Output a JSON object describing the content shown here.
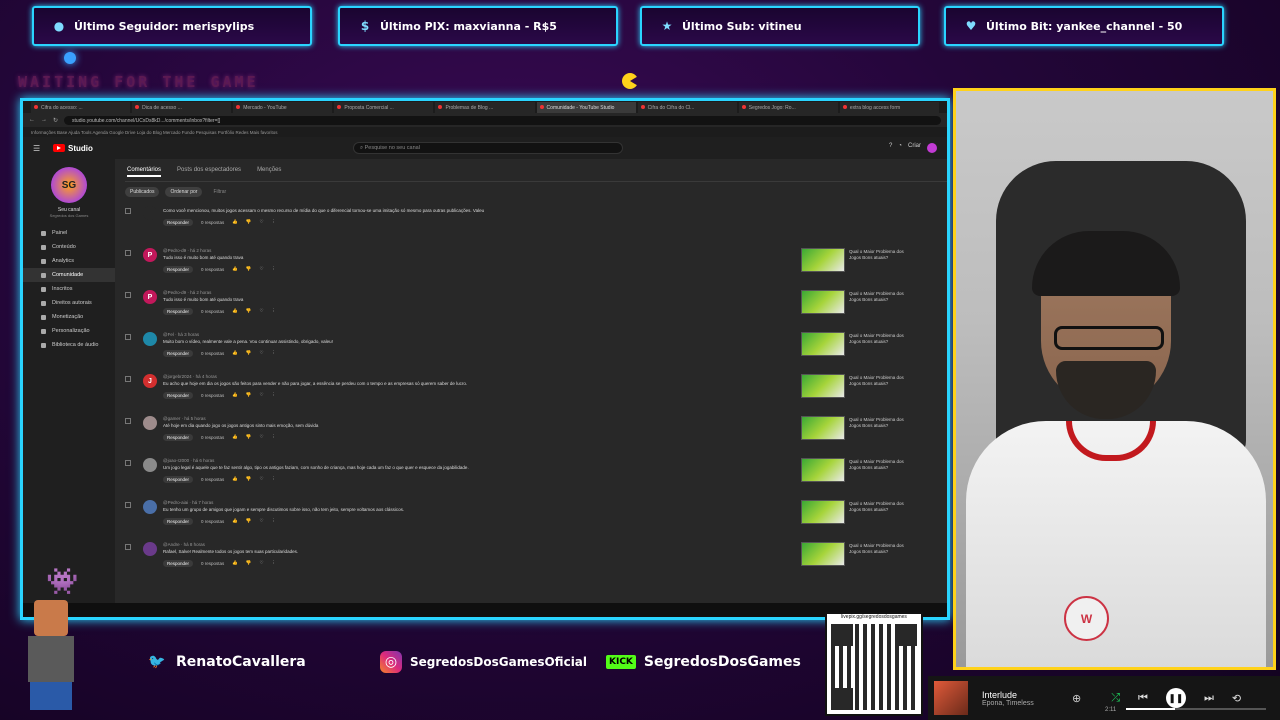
{
  "alerts": {
    "follower": "Último Seguidor: merispylips",
    "pix": "Último PIX: maxvianna - R$5",
    "sub": "Último Sub: vitineu",
    "bit": "Último Bit: yankee_channel - 50"
  },
  "overlay": {
    "waiting": "WAITING FOR THE GAME"
  },
  "browser": {
    "tabs": [
      "Cifra do acesso: ...",
      "Dica de acesso ...",
      "Mercado - YouTube",
      "Proposta Comercial ...",
      "Problemas de Blog ...",
      "Comunidade - YouTube Studio",
      "Cifra do Cifra do Cl...",
      "Segredos Jogo: Ro...",
      "extra blog access form"
    ],
    "url": "studio.youtube.com/channel/UCxDs8kD.../comments/inbox?filter=[]",
    "bookmarks": "Informações  Base  Ajuda  Tools  Agenda  Google Drive  Loja do Blog  Mercado  Fundo  Pesquisas  Portfólio  Redes  Mais favoritos"
  },
  "studio": {
    "logo_text": "Studio",
    "search_placeholder": "Pesquise no seu canal",
    "create_label": "Criar",
    "channel_name": "Seu canal",
    "channel_sub": "Segredos dos Games",
    "nav": [
      "Painel",
      "Conteúdo",
      "Analytics",
      "Comunidade",
      "Inscritos",
      "Direitos autorais",
      "Monetização",
      "Personalização",
      "Biblioteca de áudio"
    ],
    "content_tabs": [
      "Comentários",
      "Posts dos espectadores",
      "Menções"
    ],
    "filters": [
      "Publicados",
      "Ordenar por",
      "Filtrar"
    ],
    "reply_label": "Responder",
    "replies_label": "0 respostas",
    "video_title": "Qual o Maior Problema dos Jogos Bons atuais?",
    "comments": [
      {
        "initial": "",
        "color": "#282828",
        "meta": "",
        "text": "Como você mencionou, muitos jogos acessam o mesmo recurso de mídia do que o diferencial tornou-se uma imitação só mesmo para outras publicações. Valeu"
      },
      {
        "initial": "P",
        "color": "#c2185b",
        "meta": "@Pedro-d9 · há 2 horas",
        "text": "Tudo isso é muito bom até quando trava"
      },
      {
        "initial": "P",
        "color": "#c2185b",
        "meta": "@Pedro-d9 · há 2 horas",
        "text": "Tudo isso é muito bom até quando trava"
      },
      {
        "initial": "",
        "color": "#1e88a8",
        "meta": "@Fel · há 3 horas",
        "text": "Muito bom o vídeo, realmente vale a pena. Vou continuar assistindo, obrigado, valeu!"
      },
      {
        "initial": "J",
        "color": "#d32f2f",
        "meta": "@jorgebr2024 · há 4 horas",
        "text": "Eu acho que hoje em dia os jogos são feitos para vender e não para jogar, a essência se perdeu com o tempo e as empresas só querem saber de lucro."
      },
      {
        "initial": "",
        "color": "#9e8c8c",
        "meta": "@gamer · há 5 horas",
        "text": "Até hoje em dia quando jogo os jogos antigos sinto mais emoção, sem dúvida"
      },
      {
        "initial": "",
        "color": "#8a8a8a",
        "meta": "@joao-r2000 · há 6 horas",
        "text": "Um jogo legal é aquele que te faz sentir algo, tipo os antigos faziam, com sonho de criança, mas hoje cada um faz o que quer e esquece da jogabilidade."
      },
      {
        "initial": "",
        "color": "#4a6fa8",
        "meta": "@Pedro-aiai · há 7 horas",
        "text": "Eu tenho um grupo de amigos que jogam e sempre discutimos sobre isso, não tem jeito, sempre voltamos aos clássicos."
      },
      {
        "initial": "",
        "color": "#6a3a8a",
        "meta": "@Andre · há 8 horas",
        "text": "Rafael, Salve! Realmente todos os jogos tem suas particularidades."
      }
    ]
  },
  "social": {
    "twitter": "RenatoCavallera",
    "instagram": "SegredosDosGamesOficial",
    "kick_badge": "KICK",
    "kick": "SegredosDosGames"
  },
  "qr": {
    "url": "livepix.gg/segredosdosgames"
  },
  "player": {
    "track": "Interlude",
    "artist": "Epona, Timeless",
    "time": "2:11",
    "progress": 0.35
  },
  "camera": {
    "shirt_badge": "W"
  }
}
